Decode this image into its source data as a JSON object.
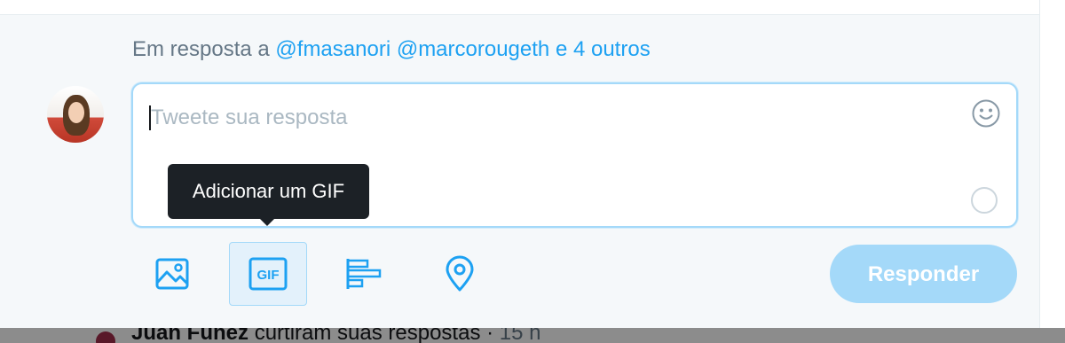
{
  "reply_context": {
    "prefix": "Em resposta a",
    "mentions": [
      "@fmasanori",
      "@marcorougeth"
    ],
    "others": "e 4 outros"
  },
  "compose": {
    "placeholder": "Tweete sua resposta",
    "emoji_icon": "smiley-icon",
    "counter_icon": "character-counter-ring"
  },
  "tooltip": {
    "text": "Adicionar um GIF"
  },
  "toolbar": {
    "tools": [
      {
        "name": "media",
        "icon": "image-icon"
      },
      {
        "name": "gif",
        "icon": "gif-icon",
        "label": "GIF"
      },
      {
        "name": "poll",
        "icon": "poll-icon"
      },
      {
        "name": "location",
        "icon": "location-pin-icon"
      }
    ],
    "reply_label": "Responder"
  },
  "below_item": {
    "name": "Juan Funez",
    "action": "curtiram suas respostas",
    "time": "15 h"
  },
  "colors": {
    "accent": "#1da1f2",
    "accent_light": "#a4d9f9",
    "muted_text": "#657786",
    "placeholder": "#aab8c2",
    "tooltip_bg": "#1c2126",
    "panel_bg": "#f5f8fa"
  }
}
